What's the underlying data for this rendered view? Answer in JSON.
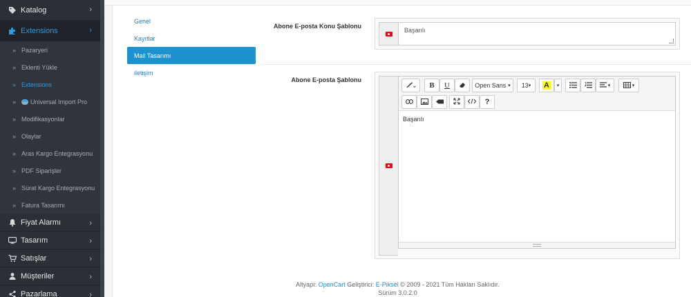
{
  "sidebar": {
    "items": [
      {
        "label": "Katalog",
        "icon": "tags-icon"
      },
      {
        "label": "Extensions",
        "icon": "puzzle-icon",
        "active": true
      },
      {
        "label": "Fiyat Alarmı",
        "icon": "bell-icon"
      },
      {
        "label": "Tasarım",
        "icon": "monitor-icon"
      },
      {
        "label": "Satışlar",
        "icon": "cart-icon"
      },
      {
        "label": "Müşteriler",
        "icon": "user-icon"
      },
      {
        "label": "Pazarlama",
        "icon": "share-icon"
      }
    ],
    "sub_items": [
      {
        "label": "Pazaryeri"
      },
      {
        "label": "Eklenti Yükle"
      },
      {
        "label": "Extensions",
        "active": true
      },
      {
        "label": "Universal Import Pro"
      },
      {
        "label": "Modifikasyonlar"
      },
      {
        "label": "Olaylar"
      },
      {
        "label": "Aras Kargo Entegrasyonu"
      },
      {
        "label": "PDF Siparişler"
      },
      {
        "label": "Sürat Kargo Entegrasyonu"
      },
      {
        "label": "Fatura Tasarımı"
      }
    ]
  },
  "tabs": [
    {
      "label": "Genel"
    },
    {
      "label": "Kayıtlar"
    },
    {
      "label": "Mail Tasarımı",
      "active": true
    },
    {
      "label": "iletişim"
    }
  ],
  "form": {
    "subject_label": "Abone E-posta Konu Şablonu",
    "subject_value": "Başarılı",
    "template_label": "Abone E-posta Şablonu",
    "template_value": "Başarılı",
    "flag": "turkey-flag-icon"
  },
  "editor": {
    "font_name": "Open Sans",
    "font_size": "13",
    "bold": "B",
    "underline": "U",
    "color_letter": "A",
    "help": "?"
  },
  "footer": {
    "altyapi_prefix": "Altyapı:",
    "altyapi_link": "OpenCart",
    "gelistirici_prefix": "Geliştirici:",
    "gelistirici_link": "E-Piksel",
    "copyright": "© 2009 - 2021 Tüm Hakları Saklıdır.",
    "version": "Sürüm 3.0.2.0"
  },
  "colors": {
    "sidebar_bg": "#2b2f36",
    "accent": "#1e91cf",
    "link": "#2a7db8"
  }
}
